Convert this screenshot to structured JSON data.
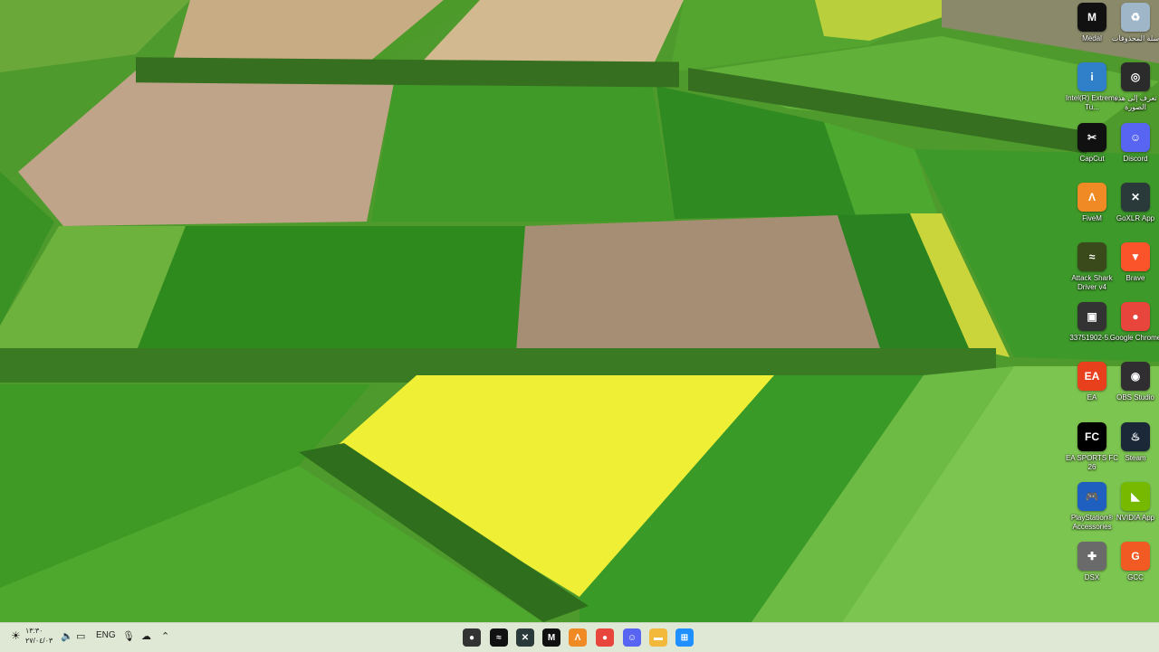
{
  "desktop_icons": [
    {
      "id": "medal",
      "label": "Medal",
      "glyph": "M",
      "icon": "medal-icon",
      "color": "#111111"
    },
    {
      "id": "recycle-bin",
      "label": "سلة المحذوفات",
      "glyph": "♻",
      "icon": "recycle-bin-icon",
      "color": "#9fb6c8"
    },
    {
      "id": "intel",
      "label": "Intel(R) Extreme Tu...",
      "glyph": "i",
      "icon": "intel-icon",
      "color": "#2f7fc9"
    },
    {
      "id": "learn-image",
      "label": "تعرف إلى هذه الصورة",
      "glyph": "◎",
      "icon": "camera-icon",
      "color": "#2b2b2b"
    },
    {
      "id": "capcut",
      "label": "CapCut",
      "glyph": "✂",
      "icon": "capcut-icon",
      "color": "#111111"
    },
    {
      "id": "discord",
      "label": "Discord",
      "glyph": "☺",
      "icon": "discord-icon",
      "color": "#5865f2"
    },
    {
      "id": "fivem",
      "label": "FiveM",
      "glyph": "Λ",
      "icon": "fivem-icon",
      "color": "#f08a24"
    },
    {
      "id": "goxlr",
      "label": "GoXLR App",
      "glyph": "✕",
      "icon": "goxlr-icon",
      "color": "#2a3a3a"
    },
    {
      "id": "attack-shark",
      "label": "Attack Shark Driver v4",
      "glyph": "≈",
      "icon": "attack-shark-icon",
      "color": "#3a4a1a"
    },
    {
      "id": "brave",
      "label": "Brave",
      "glyph": "▼",
      "icon": "brave-icon",
      "color": "#fb542b"
    },
    {
      "id": "image-file",
      "label": "33751902-5...",
      "glyph": "▣",
      "icon": "image-file-icon",
      "color": "#333333"
    },
    {
      "id": "chrome",
      "label": "Google Chrome",
      "glyph": "●",
      "icon": "chrome-icon",
      "color": "#e8453c"
    },
    {
      "id": "ea",
      "label": "EA",
      "glyph": "EA",
      "icon": "ea-icon",
      "color": "#e8401c"
    },
    {
      "id": "obs",
      "label": "OBS Studio",
      "glyph": "◉",
      "icon": "obs-icon",
      "color": "#302e31"
    },
    {
      "id": "ea-fc",
      "label": "EA SPORTS FC 26",
      "glyph": "FC",
      "icon": "ea-fc-icon",
      "color": "#000000"
    },
    {
      "id": "steam",
      "label": "Steam",
      "glyph": "♨",
      "icon": "steam-icon",
      "color": "#1b2838"
    },
    {
      "id": "ps-accessories",
      "label": "PlayStation® Accessories",
      "glyph": "🎮",
      "icon": "playstation-icon",
      "color": "#1f5fbf"
    },
    {
      "id": "nvidia",
      "label": "NVIDIA App",
      "glyph": "◣",
      "icon": "nvidia-icon",
      "color": "#76b900"
    },
    {
      "id": "dsx",
      "label": "DSX",
      "glyph": "✚",
      "icon": "dsx-icon",
      "color": "#6a6a6a"
    },
    {
      "id": "gcc",
      "label": "GCC",
      "glyph": "G",
      "icon": "gcc-icon",
      "color": "#f15a22"
    }
  ],
  "taskbar": {
    "apps": [
      {
        "id": "app-unknown",
        "glyph": "●",
        "icon": "app-icon",
        "color": "#333333"
      },
      {
        "id": "app-attack-shark",
        "glyph": "≈",
        "icon": "attack-shark-icon",
        "color": "#111111"
      },
      {
        "id": "app-goxlr",
        "glyph": "✕",
        "icon": "goxlr-icon",
        "color": "#2a3a3a"
      },
      {
        "id": "app-medal",
        "glyph": "M",
        "icon": "medal-icon",
        "color": "#111111"
      },
      {
        "id": "app-fivem",
        "glyph": "Λ",
        "icon": "fivem-icon",
        "color": "#f08a24"
      },
      {
        "id": "app-chrome",
        "glyph": "●",
        "icon": "chrome-icon",
        "color": "#e8453c"
      },
      {
        "id": "app-discord",
        "glyph": "☺",
        "icon": "discord-icon",
        "color": "#5865f2"
      },
      {
        "id": "app-explorer",
        "glyph": "▬",
        "icon": "folder-icon",
        "color": "#f2b93a"
      },
      {
        "id": "app-start",
        "glyph": "⊞",
        "icon": "windows-start-icon",
        "color": "#1e90ff"
      }
    ],
    "tray": {
      "time": "١٣:٣٠",
      "date": "٢٧/٠٤/٠٣",
      "language": "ENG"
    }
  }
}
